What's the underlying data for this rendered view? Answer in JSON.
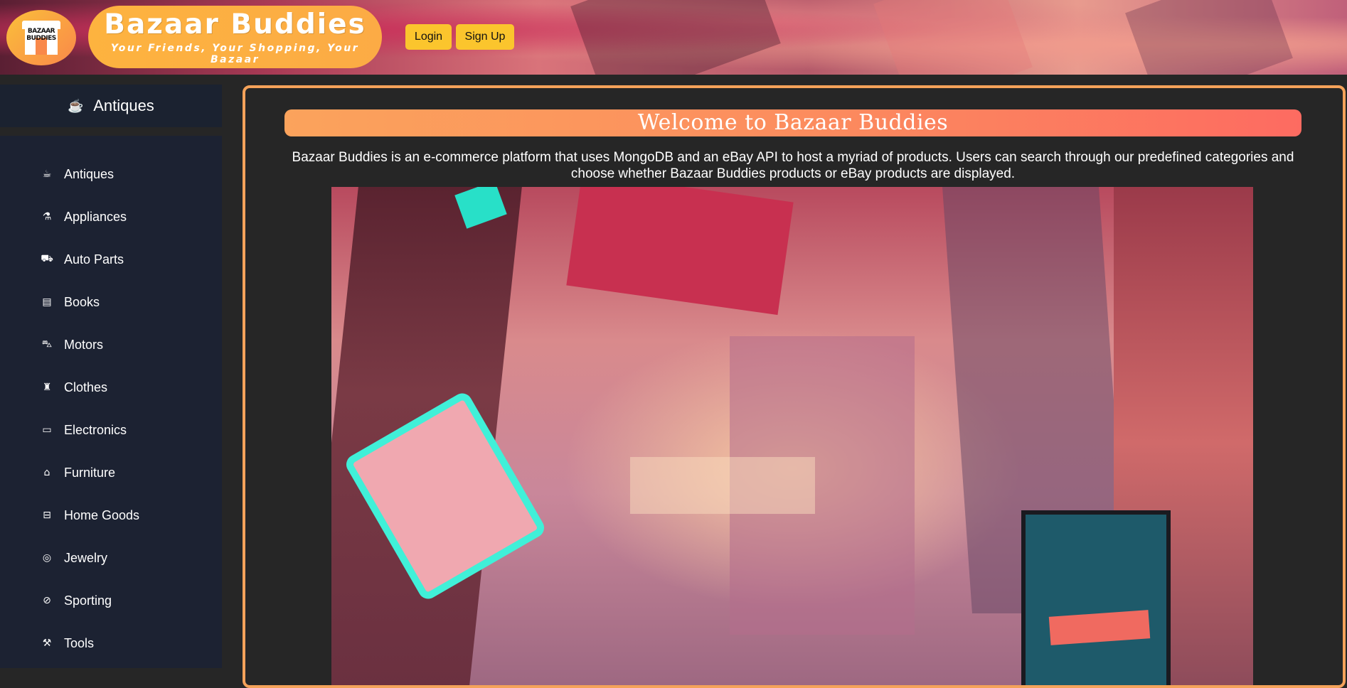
{
  "header": {
    "logo_text": "BAZAAR BUDDIES",
    "brand_title": "Bazaar Buddies",
    "brand_tagline": "Your Friends, Your Shopping, Your Bazaar",
    "login_label": "Login",
    "signup_label": "Sign Up"
  },
  "sidebar": {
    "heading": {
      "label": "Antiques",
      "icon": "mug-icon"
    },
    "items": [
      {
        "label": "Antiques",
        "icon": "mug-icon",
        "glyph": "☕"
      },
      {
        "label": "Appliances",
        "icon": "blender-icon",
        "glyph": "⚗"
      },
      {
        "label": "Auto Parts",
        "icon": "bus-icon",
        "glyph": "⛟"
      },
      {
        "label": "Books",
        "icon": "book-icon",
        "glyph": "▤"
      },
      {
        "label": "Motors",
        "icon": "car-icon",
        "glyph": "⛍"
      },
      {
        "label": "Clothes",
        "icon": "shirt-icon",
        "glyph": "♜"
      },
      {
        "label": "Electronics",
        "icon": "monitor-icon",
        "glyph": "▭"
      },
      {
        "label": "Furniture",
        "icon": "couch-icon",
        "glyph": "⌂"
      },
      {
        "label": "Home Goods",
        "icon": "bed-icon",
        "glyph": "⊟"
      },
      {
        "label": "Jewelry",
        "icon": "watch-icon",
        "glyph": "◎"
      },
      {
        "label": "Sporting",
        "icon": "football-icon",
        "glyph": "⊘"
      },
      {
        "label": "Tools",
        "icon": "hammer-icon",
        "glyph": "⚒"
      }
    ]
  },
  "main": {
    "welcome_title": "Welcome to Bazaar Buddies",
    "description": "Bazaar Buddies is an e-commerce platform that uses MongoDB and an eBay API to host a myriad of products. Users can search through our predefined categories and choose whether Bazaar Buddies products or eBay products are displayed."
  },
  "colors": {
    "accent_orange": "#f4a25a",
    "button_yellow": "#fbc52d",
    "sidebar_bg": "#1c2232",
    "page_bg": "#262626"
  }
}
